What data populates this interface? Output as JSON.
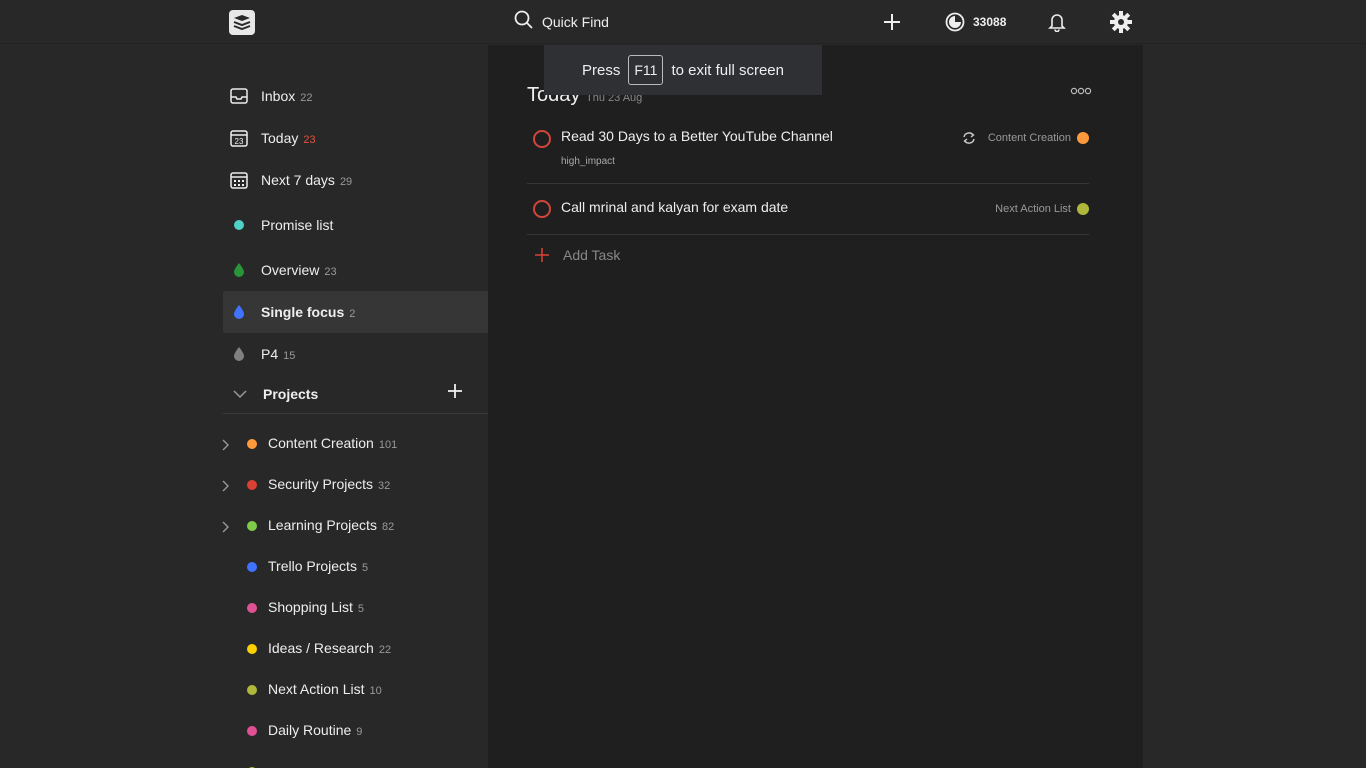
{
  "topbar": {
    "search_label": "Quick Find",
    "karma": "33088"
  },
  "toast": {
    "press": "Press",
    "key": "F11",
    "rest": "to exit full screen"
  },
  "filters": [
    {
      "label": "Inbox",
      "count": "22"
    },
    {
      "label": "Today",
      "count": "23",
      "today_day": "23"
    },
    {
      "label": "Next 7 days",
      "count": "29"
    },
    {
      "label": "Promise list",
      "count": ""
    },
    {
      "label": "Overview",
      "count": "23"
    },
    {
      "label": "Single focus",
      "count": "2"
    },
    {
      "label": "P4",
      "count": "15"
    }
  ],
  "projects_header": "Projects",
  "projects": [
    {
      "label": "Content Creation",
      "count": "101",
      "color": "#ff9a3c"
    },
    {
      "label": "Security Projects",
      "count": "32",
      "color": "#db4035"
    },
    {
      "label": "Learning Projects",
      "count": "82",
      "color": "#7ecc49"
    },
    {
      "label": "Trello Projects",
      "count": "5",
      "color": "#4073ff"
    },
    {
      "label": "Shopping List",
      "count": "5",
      "color": "#e05194"
    },
    {
      "label": "Ideas / Research",
      "count": "22",
      "color": "#fad000"
    },
    {
      "label": "Next Action List",
      "count": "10",
      "color": "#afb83b"
    },
    {
      "label": "Daily Routine",
      "count": "9",
      "color": "#e05194"
    }
  ],
  "colors": {
    "promise": "#4fd1c5",
    "overview": "#299438",
    "single_focus": "#4073ff",
    "p4": "#808080",
    "accent": "#db4035"
  },
  "view": {
    "title": "Today",
    "date": "Thu 23 Aug",
    "add_task": "Add Task"
  },
  "tasks": [
    {
      "content": "Read 30 Days to a Better YouTube Channel",
      "label": "high_impact",
      "project": "Content Creation",
      "project_color": "#ff9a3c",
      "recurring": true
    },
    {
      "content": "Call mrinal and kalyan for exam date",
      "label": "",
      "project": "Next Action List",
      "project_color": "#afb83b",
      "recurring": false
    }
  ]
}
